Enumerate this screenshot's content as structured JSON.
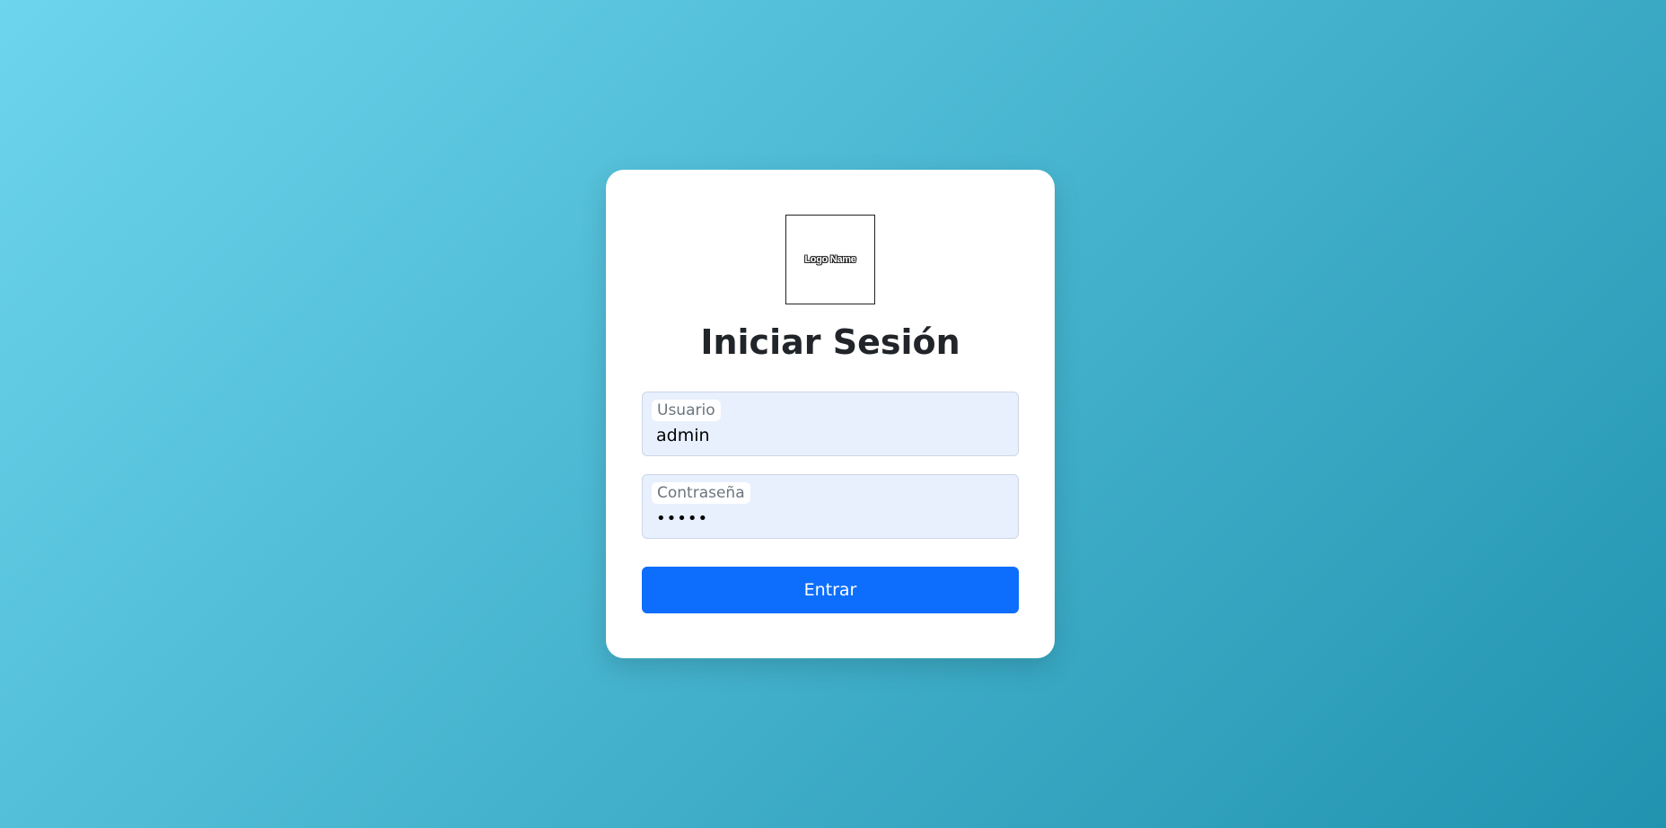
{
  "logo": {
    "text": "Logo Name"
  },
  "login": {
    "title": "Iniciar Sesión",
    "username": {
      "label": "Usuario",
      "value": "admin"
    },
    "password": {
      "label": "Contraseña",
      "value": "12345"
    },
    "submit_label": "Entrar"
  },
  "colors": {
    "background_gradient_start": "#6dd5ed",
    "background_gradient_end": "#2193b0",
    "card": "#ffffff",
    "input_fill": "#e8f0fe",
    "button": "#0d6efd",
    "button_text": "#ffffff",
    "title": "#212529"
  }
}
